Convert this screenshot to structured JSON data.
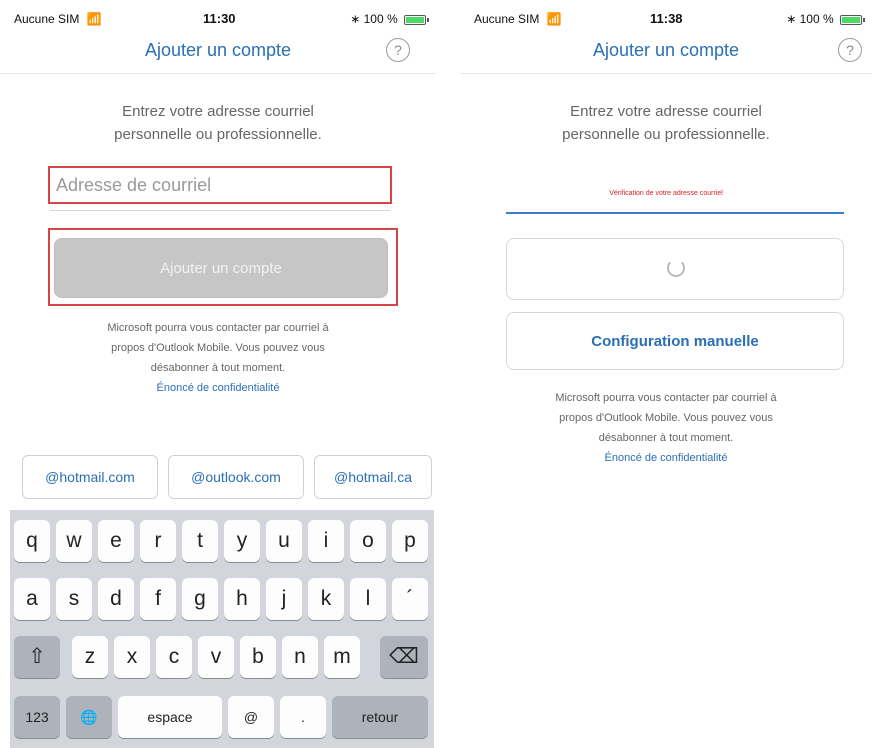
{
  "left": {
    "status": {
      "carrier": "Aucune SIM",
      "time": "11:30",
      "battery": "100 %",
      "wifi_icon": "wifi-icon",
      "bluetooth_icon": "bluetooth-icon"
    },
    "nav": {
      "title": "Ajouter un compte",
      "help": "?"
    },
    "prompt": {
      "line1": "Entrez votre adresse courriel",
      "line2": "personnelle ou professionnelle."
    },
    "email": {
      "placeholder": "Adresse de courriel",
      "value": ""
    },
    "add_button": "Ajouter un compte",
    "disclaimer": {
      "line1": "Microsoft pourra vous contacter par courriel à",
      "line2": "propos d'Outlook Mobile. Vous pouvez vous",
      "line3": "désabonner à tout moment.",
      "link": "Énoncé de confidentialité"
    },
    "suggestions": [
      "@hotmail.com",
      "@outlook.com",
      "@hotmail.ca"
    ],
    "keyboard": {
      "row1": [
        "q",
        "w",
        "e",
        "r",
        "t",
        "y",
        "u",
        "i",
        "o",
        "p"
      ],
      "row2": [
        "a",
        "s",
        "d",
        "f",
        "g",
        "h",
        "j",
        "k",
        "l",
        "´"
      ],
      "row3": [
        "z",
        "x",
        "c",
        "v",
        "b",
        "n",
        "m"
      ],
      "shift": "⇧",
      "backspace": "⌫",
      "numbers": "123",
      "globe": "🌐",
      "space": "espace",
      "at": "@",
      "dot": ".",
      "return": "retour"
    }
  },
  "right": {
    "status": {
      "carrier": "Aucune SIM",
      "time": "11:38",
      "battery": "100 %",
      "wifi_icon": "wifi-icon",
      "bluetooth_icon": "bluetooth-icon"
    },
    "nav": {
      "title": "Ajouter un compte",
      "help": "?"
    },
    "prompt": {
      "line1": "Entrez votre adresse courriel",
      "line2": "personnelle ou professionnelle."
    },
    "verify_text": "Vérification de votre adresse courriel",
    "manual_button": "Configuration manuelle",
    "disclaimer": {
      "line1": "Microsoft pourra vous contacter par courriel à",
      "line2": "propos d'Outlook Mobile. Vous pouvez vous",
      "line3": "désabonner à tout moment.",
      "link": "Énoncé de confidentialité"
    }
  },
  "colors": {
    "accent": "#2a6fb5",
    "highlight": "#d64545",
    "battery": "#4cd964",
    "keyboard": "#d2d5db"
  }
}
